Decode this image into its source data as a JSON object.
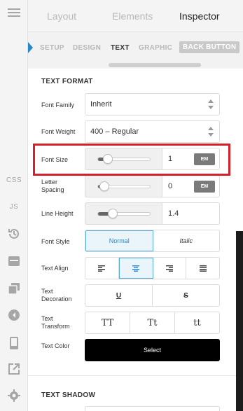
{
  "rail": {
    "css_label": "CSS",
    "js_label": "JS",
    "icons": [
      "menu-icon",
      "history-icon",
      "layout-icon",
      "duplicate-icon",
      "back-icon",
      "mobile-icon",
      "export-icon",
      "gear-icon"
    ]
  },
  "top_tabs": {
    "layout": "Layout",
    "elements": "Elements",
    "inspector": "Inspector"
  },
  "sub_tabs": {
    "setup": "SETUP",
    "design": "DESIGN",
    "text": "TEXT",
    "graphic": "GRAPHIC",
    "back_button": "BACK BUTTON"
  },
  "text_format": {
    "title": "TEXT FORMAT",
    "font_family": {
      "label": "Font Family",
      "value": "Inherit"
    },
    "font_weight": {
      "label": "Font Weight",
      "value": "400 – Regular"
    },
    "font_size": {
      "label": "Font Size",
      "value": "1",
      "unit": "EM",
      "level": 0.18
    },
    "letter_spacing": {
      "label": "Letter Spacing",
      "value": "0",
      "unit": "EM",
      "level": 0.12
    },
    "line_height": {
      "label": "Line Height",
      "value": "1.4",
      "level": 0.28
    },
    "font_style": {
      "label": "Font Style",
      "options": [
        "Normal",
        "Italic"
      ],
      "selected": "Normal"
    },
    "text_align": {
      "label": "Text Align",
      "options": [
        "align-left-icon",
        "align-center-icon",
        "align-right-icon",
        "align-justify-icon"
      ],
      "selected": "align-center-icon"
    },
    "text_decoration": {
      "label": "Text Decoration",
      "options": [
        "U",
        "S"
      ]
    },
    "text_transform": {
      "label": "Text Transform",
      "options": [
        "TT",
        "Tt",
        "tt"
      ]
    },
    "text_color": {
      "label": "Text Color",
      "button": "Select",
      "value": "#000000"
    }
  },
  "text_shadow": {
    "title": "TEXT SHADOW"
  },
  "colors": {
    "accent": "#2b86c9",
    "highlight": "#d4202b"
  }
}
